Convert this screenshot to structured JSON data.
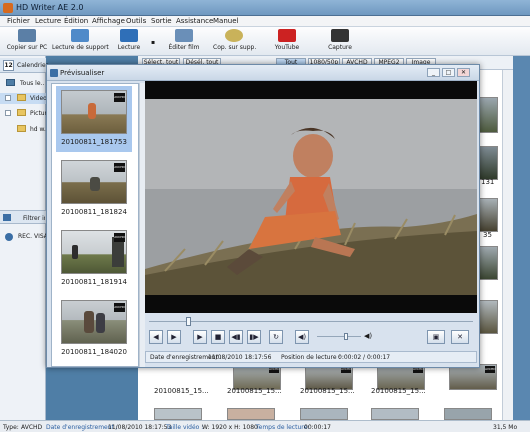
{
  "app": {
    "title": "HD Writer AE 2.0"
  },
  "menu": [
    "Fichier",
    "Lecture",
    "Édition",
    "Affichage",
    "Outils",
    "Sortie",
    "Assistance",
    "Manuel"
  ],
  "toolbar": {
    "copy_pc": "Copier sur PC",
    "read_media": "Lecture de support",
    "play": "Lecture",
    "edit_film": "Éditer film",
    "copy_media": "Cop. sur supp.",
    "youtube": "YouTube",
    "capture": "Capture"
  },
  "left": {
    "calendar_day": "12",
    "calendar_label": "Calendrier",
    "tree": [
      "Tous le...",
      "Video",
      "Pictur...",
      "hd w..."
    ],
    "filter_label": "Filtrer imag...",
    "rec_label": "REC. VISA"
  },
  "filter": {
    "select_all": "Sélect. tout",
    "deselect_all": "Désél. tout",
    "tabs": [
      "Tout",
      "1080/50p",
      "AVCHD",
      "MPEG2",
      "Image"
    ]
  },
  "grid": {
    "captions": [
      "20100815_15...",
      "20100815_15...",
      "20100815_15...",
      "20100815_15..."
    ],
    "side_labels": [
      "131",
      "35"
    ]
  },
  "preview": {
    "title": "Prévisualiser",
    "items": [
      {
        "label": "20100811_181753",
        "selected": true
      },
      {
        "label": "20100811_181824",
        "selected": false
      },
      {
        "label": "20100811_181914",
        "selected": false
      },
      {
        "label": "20100811_184020",
        "selected": false
      }
    ],
    "badge": "AVCHD",
    "info": {
      "rec_label": "Date d'enregistrement :",
      "rec_value": "11/08/2010 18:17:56",
      "pos_label": "Position de lecture :",
      "pos_value": "0:00:02 / 0:00:17"
    },
    "seek_fraction": 0.12,
    "volume_fraction": 0.65
  },
  "status": {
    "type_label": "Type:",
    "type_value": "AVCHD",
    "date_label": "Date d'enregistrement :",
    "date_value": "11/08/2010 18:17:53",
    "size_label": "Taille vidéo :",
    "size_value": "W: 1920 x H: 1080",
    "time_label": "Temps de lecture:",
    "time_value": "00:00:17",
    "file_size": "31,5 Mo"
  },
  "colors": {
    "accent": "#3a6ea5",
    "youtube": "#cc2222",
    "selection": "#a9c8ee"
  }
}
